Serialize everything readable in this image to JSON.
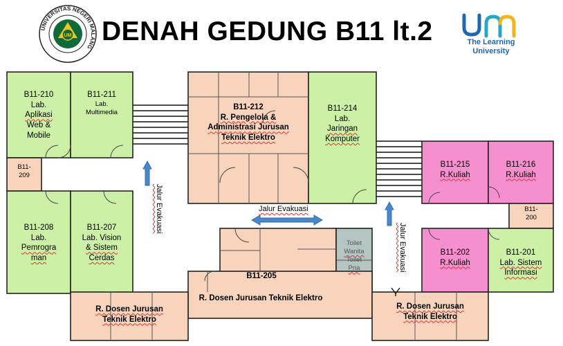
{
  "header": {
    "title": "DENAH GEDUNG B11 lt.2",
    "logo_um_line1": "The Learning",
    "logo_um_line2": "University",
    "seal_text": "UNIVERSITAS NEGERI MALANG"
  },
  "colors": {
    "lab_green": "#ccf0a6",
    "office_peach": "#f8d4bc",
    "classroom_pink": "#f58fd0",
    "toilet_grey": "#b5c6c2",
    "evac_arrow": "#2f6fb5",
    "um_blue": "#1d67b3",
    "um_yellow": "#f2b41d"
  },
  "rooms": {
    "r210": {
      "code": "B11-210",
      "l1": "Lab.",
      "l2": "Aplikasi",
      "l3": "Web &",
      "l4": "Mobile"
    },
    "r211": {
      "code": "B11-211",
      "l1": "Lab.",
      "l2": "Multimedia"
    },
    "r209": {
      "code": "B11-",
      "l2": "209"
    },
    "r212": {
      "code": "B11-212",
      "l1": "R. Pengelola &",
      "l2": "Administrasi Jurusan",
      "l3": "Teknik Elektro"
    },
    "r214": {
      "code": "B11-214",
      "l1": "Lab.",
      "l2": "Jaringan",
      "l3": "Komputer"
    },
    "r215": {
      "code": "B11-215",
      "l1": "R.Kuliah"
    },
    "r216": {
      "code": "B11-216",
      "l1": "R.Kuliah"
    },
    "r200": {
      "code": "B11-",
      "l2": "200"
    },
    "r208": {
      "code": "B11-208",
      "l1": "Lab.",
      "l2": "Pemrogra",
      "l3": "man"
    },
    "r207": {
      "code": "B11-207",
      "l1": "Lab. Vision",
      "l2": "& Sistem",
      "l3": "Cerdas"
    },
    "r205": {
      "code": "B11-205",
      "l1": "R. Dosen Jurusan Teknik Elektro"
    },
    "toilet": {
      "l1": "Toilet",
      "l2": "Wanita",
      "l3": "Toilet",
      "l4": "Pria"
    },
    "r202": {
      "code": "B11-202",
      "l1": "R.Kuliah"
    },
    "r201": {
      "code": "B11-201",
      "l1": "Lab. Sistem",
      "l2": "Informasi"
    },
    "dosen_left": {
      "l1": "R. Dosen Jurusan",
      "l2": "Teknik Elektro"
    },
    "dosen_right": {
      "l1": "R. Dosen Jurusan",
      "l2": "Teknik Elektro"
    }
  },
  "evacuation": {
    "label_h": "Jalur Evakuasi",
    "label_v1": "Jalur Evakuasi",
    "label_v2": "Jalur Evakuasi"
  }
}
